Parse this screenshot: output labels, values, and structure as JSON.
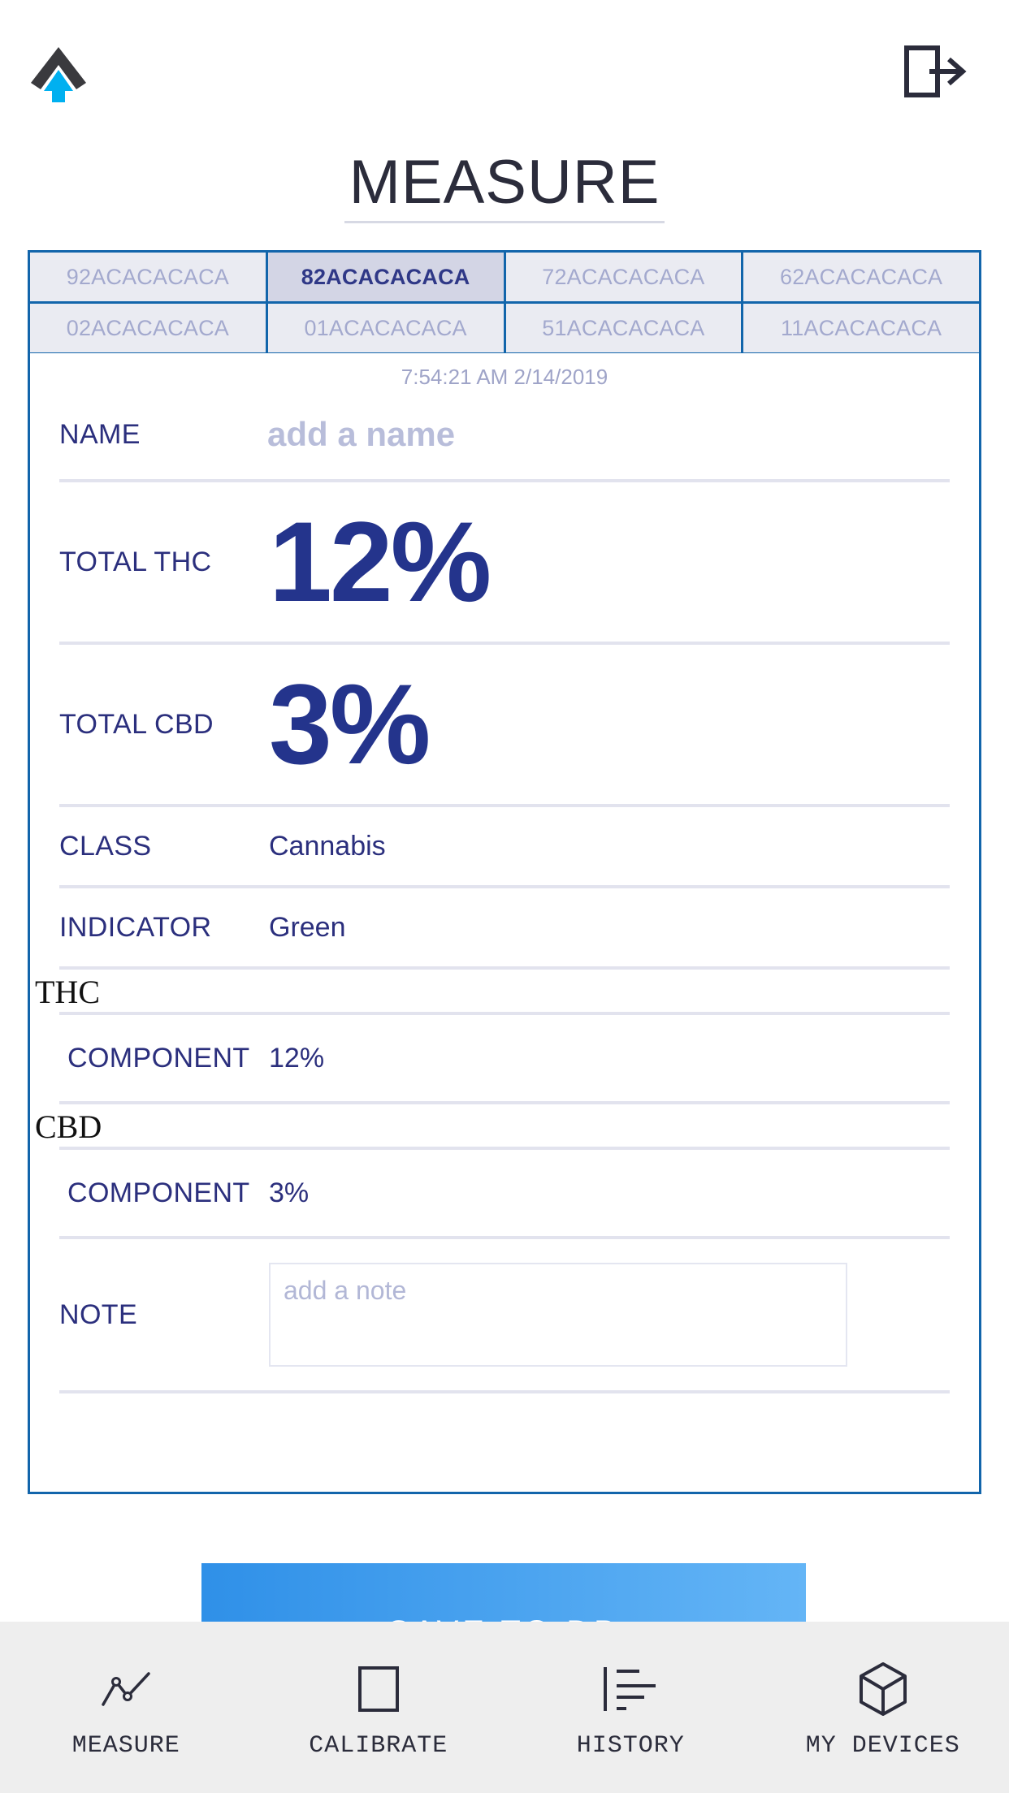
{
  "header": {
    "logo_icon": "upload-arrow-logo-icon",
    "logout_icon": "logout-icon",
    "logout_label": "Logout"
  },
  "page_title": "MEASURE",
  "tabs": {
    "items": [
      {
        "label": "92ACACACACA",
        "active": false
      },
      {
        "label": "82ACACACACA",
        "active": true
      },
      {
        "label": "72ACACACACA",
        "active": false
      },
      {
        "label": "62ACACACACA",
        "active": false
      },
      {
        "label": "02ACACACACA",
        "active": false
      },
      {
        "label": "01ACACACACA",
        "active": false
      },
      {
        "label": "51ACACACACA",
        "active": false
      },
      {
        "label": "11ACACACACA",
        "active": false
      }
    ]
  },
  "measurement": {
    "timestamp": "7:54:21 AM 2/14/2019",
    "name_label": "NAME",
    "name_value": "",
    "name_placeholder": "add a name",
    "total_thc_label": "TOTAL THC",
    "total_thc_value": "12%",
    "total_cbd_label": "TOTAL CBD",
    "total_cbd_value": "3%",
    "class_label": "CLASS",
    "class_value": "Cannabis",
    "indicator_label": "INDICATOR",
    "indicator_value": "Green",
    "thc_group_title": "THC",
    "thc_component_label": "COMPONENT",
    "thc_component_value": "12%",
    "cbd_group_title": "CBD",
    "cbd_component_label": "COMPONENT",
    "cbd_component_value": "3%",
    "note_label": "NOTE",
    "note_value": "",
    "note_placeholder": "add a note"
  },
  "save_button": {
    "label": "SAVE TO DB"
  },
  "bottom_nav": {
    "items": [
      {
        "label": "MEASURE",
        "icon": "line-chart-icon",
        "active": true
      },
      {
        "label": "CALIBRATE",
        "icon": "square-icon",
        "active": false
      },
      {
        "label": "HISTORY",
        "icon": "list-lines-icon",
        "active": false
      },
      {
        "label": "MY DEVICES",
        "icon": "cube-icon",
        "active": false
      }
    ]
  },
  "colors": {
    "accent_blue": "#1265ab",
    "navy": "#24348c",
    "muted_purple": "#a3a9ce",
    "button_gradient_start": "#2f90e8",
    "button_gradient_end": "#64b5f6",
    "logo_cyan": "#00b0f0",
    "logo_dark": "#3a3a3e"
  }
}
